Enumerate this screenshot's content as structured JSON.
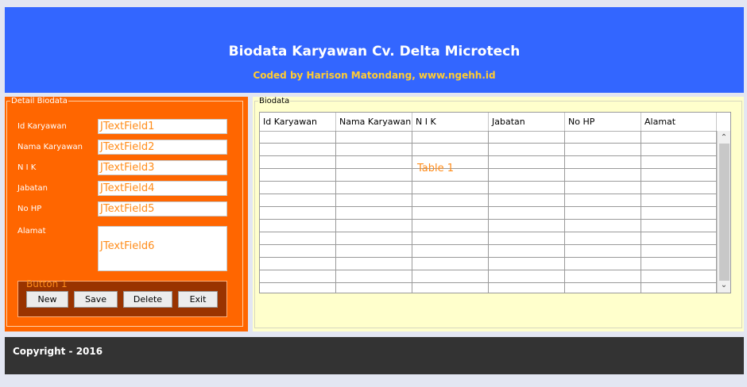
{
  "header": {
    "title": "Biodata Karyawan Cv. Delta Microtech",
    "subtitle": "Coded by Harison Matondang, www.ngehh.id"
  },
  "detail_panel": {
    "legend": "Detail Biodata",
    "fields": [
      {
        "label": "Id Karyawan",
        "value": "JTextField1"
      },
      {
        "label": "Nama Karyawan",
        "value": "JTextField2"
      },
      {
        "label": "N I K",
        "value": "JTextField3"
      },
      {
        "label": "Jabatan",
        "value": "JTextField4"
      },
      {
        "label": "No HP",
        "value": "JTextField5"
      },
      {
        "label": "Alamat",
        "value": "JTextField6"
      }
    ],
    "button_group_title": "Button 1",
    "buttons": {
      "new": "New",
      "save": "Save",
      "delete": "Delete",
      "exit": "Exit"
    }
  },
  "biodata_panel": {
    "legend": "Biodata",
    "table_label": "Table 1",
    "columns": [
      "Id Karyawan",
      "Nama Karyawan",
      "N I K",
      "Jabatan",
      "No HP",
      "Alamat"
    ],
    "empty_rows": 13
  },
  "footer": {
    "copyright": "Copyright - 2016"
  },
  "colors": {
    "header_bg": "#3366ff",
    "left_panel_bg": "#ff6600",
    "right_panel_bg": "#ffffcc",
    "footer_bg": "#333333",
    "subtitle_color": "#ffcc33",
    "placeholder_orange": "#ff8c1a"
  }
}
